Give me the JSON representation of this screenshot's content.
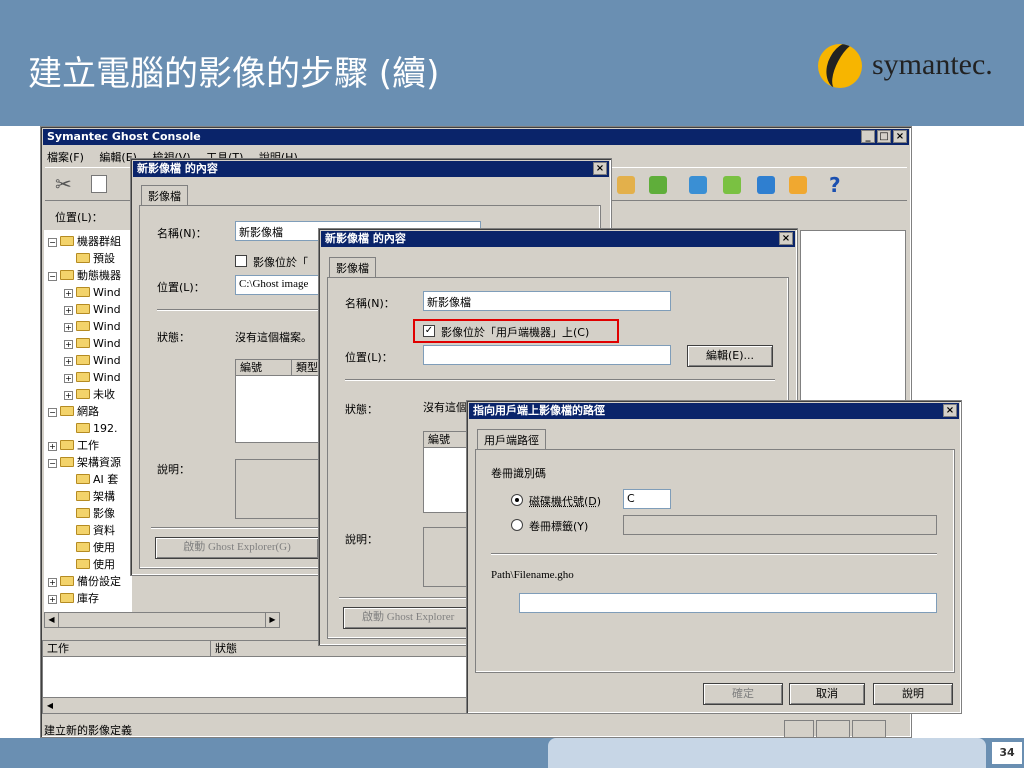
{
  "slide": {
    "title": "建立電腦的影像的步驟 (續)",
    "logo_text": "symantec.",
    "page_number": "34",
    "colors": {
      "header": "#6a8fb2",
      "titlebar": "#0a246a",
      "highlight": "#e00000"
    }
  },
  "console": {
    "title": "Symantec Ghost Console",
    "menu": [
      "檔案(F)",
      "編輯(E)",
      "檢視(V)",
      "工具(T)",
      "說明(H)"
    ],
    "location_label": "位置(L)：",
    "tree": [
      {
        "label": "機器群組",
        "sign": "−",
        "indent": 0
      },
      {
        "label": "預設",
        "sign": "",
        "indent": 1
      },
      {
        "label": "動態機器",
        "sign": "−",
        "indent": 0
      },
      {
        "label": "Wind",
        "sign": "+",
        "indent": 1
      },
      {
        "label": "Wind",
        "sign": "+",
        "indent": 1
      },
      {
        "label": "Wind",
        "sign": "+",
        "indent": 1
      },
      {
        "label": "Wind",
        "sign": "+",
        "indent": 1
      },
      {
        "label": "Wind",
        "sign": "+",
        "indent": 1
      },
      {
        "label": "Wind",
        "sign": "+",
        "indent": 1
      },
      {
        "label": "未收",
        "sign": "+",
        "indent": 1
      },
      {
        "label": "網路",
        "sign": "−",
        "indent": 0
      },
      {
        "label": "192.",
        "sign": "",
        "indent": 1
      },
      {
        "label": "工作",
        "sign": "+",
        "indent": 0
      },
      {
        "label": "架構資源",
        "sign": "−",
        "indent": 0
      },
      {
        "label": "AI 套",
        "sign": "",
        "indent": 1
      },
      {
        "label": "架構",
        "sign": "",
        "indent": 1
      },
      {
        "label": "影像",
        "sign": "",
        "indent": 1
      },
      {
        "label": "資料",
        "sign": "",
        "indent": 1
      },
      {
        "label": "使用",
        "sign": "",
        "indent": 1
      },
      {
        "label": "使用",
        "sign": "",
        "indent": 1
      },
      {
        "label": "備份設定",
        "sign": "+",
        "indent": 0
      },
      {
        "label": "庫存",
        "sign": "+",
        "indent": 0
      }
    ],
    "task_columns": [
      "工作",
      "狀態"
    ],
    "status_bar": "建立新的影像定義"
  },
  "dialog1": {
    "title": "新影像檔 的內容",
    "tab": "影像檔",
    "name_label": "名稱(N)：",
    "name_value": "新影像檔",
    "checkbox_label": "影像位於「",
    "location_label": "位置(L)：",
    "location_value": "C:\\Ghost image",
    "status_label": "狀態：",
    "status_value": "沒有這個檔案。",
    "columns": [
      "編號",
      "類型"
    ],
    "description_label": "說明：",
    "explorer_button": "啟動 Ghost Explorer(G)"
  },
  "dialog2": {
    "title": "新影像檔 的內容",
    "tab": "影像檔",
    "name_label": "名稱(N)：",
    "name_value": "新影像檔",
    "checkbox_label": "影像位於「用戶端機器」上(C)",
    "checkbox_checked": true,
    "location_label": "位置(L)：",
    "location_value": "",
    "edit_button": "編輯(E)...",
    "status_label": "狀態：",
    "status_value": "沒有這個檔案",
    "columns": [
      "編號"
    ],
    "description_label": "說明：",
    "explorer_button": "啟動 Ghost Explorer"
  },
  "dialog3": {
    "title": "指向用戶端上影像檔的路徑",
    "tab": "用戶端路徑",
    "volume_label": "卷冊識別碼",
    "radio_drive_label": "磁碟機代號(D)",
    "radio_drive_value": "C",
    "radio_volume_label": "卷冊標籤(Y)",
    "path_label": "Path\\Filename.gho",
    "path_value": "",
    "ok_button": "確定",
    "cancel_button": "取消",
    "help_button": "說明"
  }
}
